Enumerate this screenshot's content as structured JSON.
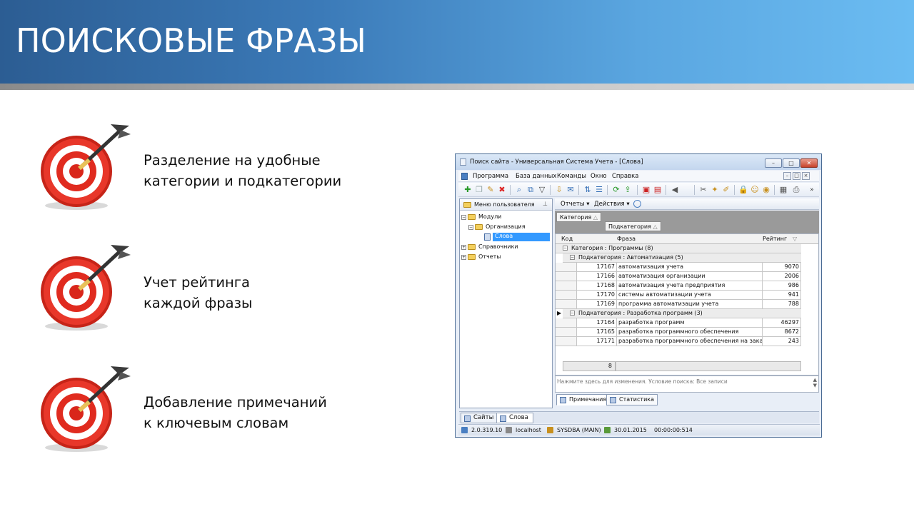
{
  "slide": {
    "title": "ПОИСКОВЫЕ ФРАЗЫ",
    "bullets": [
      {
        "line1": "Разделение на удобные",
        "line2": "категории и подкатегории"
      },
      {
        "line1": "Учет рейтинга",
        "line2": "каждой фразы"
      },
      {
        "line1": "Добавление примечаний",
        "line2": "к ключевым словам"
      }
    ]
  },
  "window": {
    "title": "Поиск сайта - Универсальная Система Учета - [Слова]",
    "menu": [
      "Программа",
      "База данных",
      "Команды",
      "Окно",
      "Справка"
    ],
    "left_panel": {
      "header": "Меню пользователя",
      "tree": {
        "modules": "Модули",
        "organization": "Организация",
        "words": "Слова",
        "references": "Справочники",
        "reports": "Отчеты"
      }
    },
    "right_toolbar": {
      "reports": "Отчеты ▾",
      "actions": "Действия ▾"
    },
    "group_chips": {
      "category": "Категория",
      "subcategory": "Подкатегория"
    },
    "columns": {
      "code": "Код",
      "phrase": "Фраза",
      "rating": "Рейтинг"
    },
    "groups": {
      "category": "Категория : Программы (8)",
      "sub1": "Подкатегория : Автоматизация (5)",
      "sub2": "Подкатегория : Разработка программ (3)"
    },
    "rows_group1": [
      {
        "code": "17167",
        "phrase": "автоматизация учета",
        "rating": "9070"
      },
      {
        "code": "17166",
        "phrase": "автоматизация организации",
        "rating": "2006"
      },
      {
        "code": "17168",
        "phrase": "автоматизация учета предприятия",
        "rating": "986"
      },
      {
        "code": "17170",
        "phrase": "системы автоматизации учета",
        "rating": "941"
      },
      {
        "code": "17169",
        "phrase": "программа автоматизации учета",
        "rating": "788"
      }
    ],
    "rows_group2": [
      {
        "code": "17164",
        "phrase": "разработка программ",
        "rating": "46297"
      },
      {
        "code": "17165",
        "phrase": "разработка программного обеспечения",
        "rating": "8672"
      },
      {
        "code": "17171",
        "phrase": "разработка программного обеспечения на заказ",
        "rating": "243"
      }
    ],
    "footer_count": "8",
    "filter_hint": "Нажмите здесь для изменения. Условие поиска: Все записи",
    "detail_tabs": [
      "Примечания",
      "Статистика"
    ],
    "bottom_tabs": [
      "Сайты",
      "Слова"
    ],
    "status": {
      "version": "2.0.319.10",
      "host": "localhost",
      "user": "SYSDBA (MAIN)",
      "date": "30.01.2015",
      "time": "00:00:00:514"
    }
  }
}
